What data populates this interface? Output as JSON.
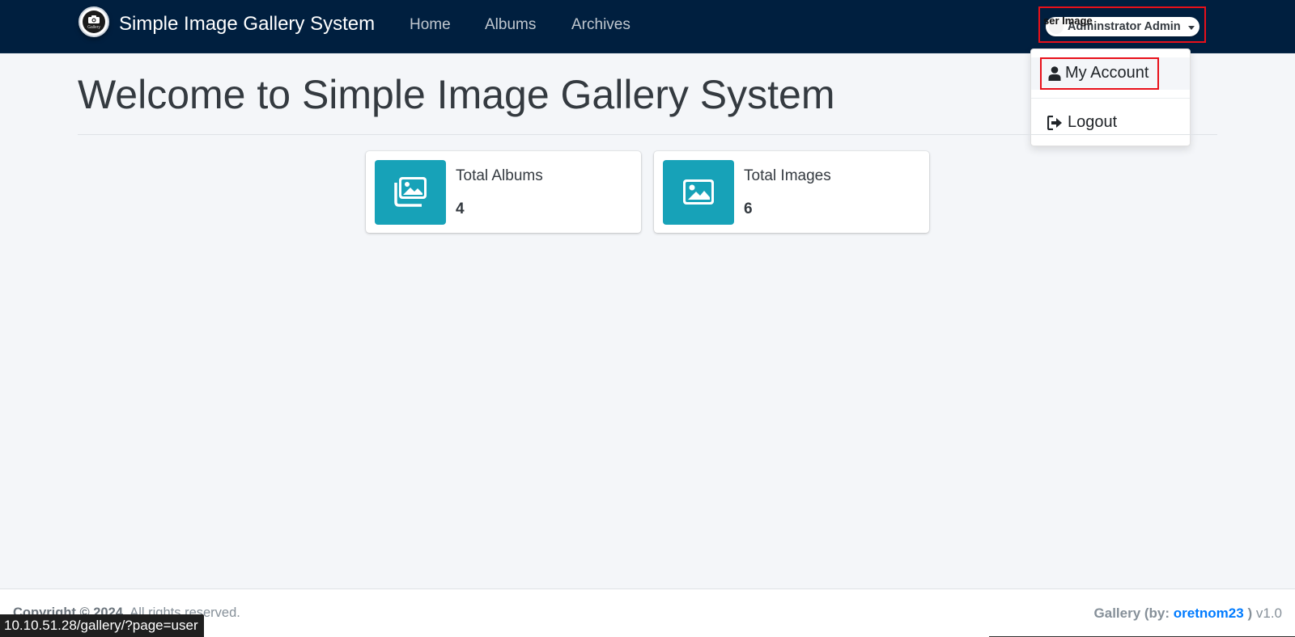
{
  "navbar": {
    "brand_name": "Simple Image Gallery System",
    "logo_text": "Gallery",
    "links": [
      "Home",
      "Albums",
      "Archives"
    ],
    "user_image_alt": "ser Image",
    "user_name": "Adminstrator Admin"
  },
  "dropdown": {
    "my_account": "My Account",
    "logout": "Logout"
  },
  "main": {
    "title": "Welcome to Simple Image Gallery System",
    "boxes": [
      {
        "label": "Total Albums",
        "value": "4",
        "icon": "images-icon"
      },
      {
        "label": "Total Images",
        "value": "6",
        "icon": "image-icon"
      }
    ]
  },
  "footer": {
    "copyright_prefix": "Copyright © 2024.",
    "copyright_suffix": "All rights reserved.",
    "credit_prefix": "Gallery (by:",
    "credit_author": "oretnom23",
    "credit_suffix": ")",
    "version": "v1.0"
  },
  "status_bar": {
    "url": "10.10.51.28/gallery/?page=user"
  },
  "colors": {
    "navbar_bg": "#001f3f",
    "info_icon_bg": "#17a2b8",
    "highlight": "#e8101a",
    "link": "#007bff"
  }
}
